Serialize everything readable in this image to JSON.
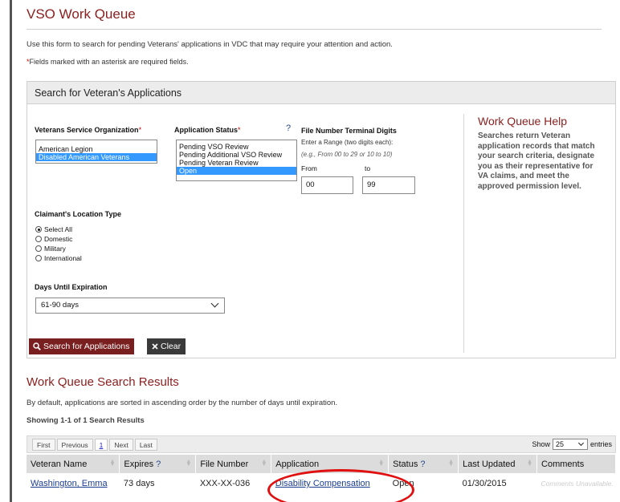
{
  "page": {
    "title": "VSO Work Queue",
    "intro": "Use this form to search for pending Veterans' applications in VDC that may require your attention and action.",
    "required_note_star": "*",
    "required_note": "Fields marked with an asterisk are required fields."
  },
  "search_panel": {
    "header": "Search for Veteran's Applications",
    "vso": {
      "label": "Veterans Service Organization",
      "required": "*",
      "options": [
        "American Legion",
        "Disabled American Veterans"
      ],
      "selected": "Disabled American Veterans"
    },
    "status": {
      "label": "Application Status",
      "required": "*",
      "help": "?",
      "options": [
        "Pending VSO Review",
        "Pending Additional VSO Review",
        "Pending Veteran Review",
        "Open"
      ],
      "selected": "Open"
    },
    "file_number": {
      "label": "File Number Terminal Digits",
      "hint": "Enter a Range (two digits each):",
      "example": "(e.g., From 00 to 29 or 10 to 10)",
      "from_label": "From",
      "to_label": "to",
      "from_value": "00",
      "to_value": "99"
    },
    "location": {
      "label": "Claimant's Location Type",
      "options": [
        "Select All",
        "Domestic",
        "Military",
        "International"
      ],
      "selected": "Select All"
    },
    "days": {
      "label": "Days Until Expiration",
      "value": "61-90 days"
    },
    "search_button": "Search for Applications",
    "clear_button": "Clear",
    "help": {
      "title": "Work Queue Help",
      "text": "Searches return Veteran application records that match your search criteria, designate you as their representative for VA claims, and meet the approved permission level."
    }
  },
  "results": {
    "title": "Work Queue Search Results",
    "description": "By default, applications are sorted in ascending order by the number of days until expiration.",
    "count": "Showing 1-1 of 1 Search Results",
    "pager": {
      "first": "First",
      "previous": "Previous",
      "current": "1",
      "next": "Next",
      "last": "Last"
    },
    "show_label": "Show",
    "show_value": "25",
    "entries_label": "entries",
    "columns": [
      "Veteran Name",
      "Expires",
      "File Number",
      "Application",
      "Status",
      "Last Updated",
      "Comments"
    ],
    "help_mark": "?",
    "rows": [
      {
        "veteran_name": "Washington, Emma",
        "expires": "73 days",
        "file_number": "XXX-XX-036",
        "application": "Disability Compensation",
        "status": "Open",
        "last_updated": "01/30/2015",
        "comments": "Comments Unavailable."
      }
    ]
  },
  "colors": {
    "accent": "#8b2020",
    "selection": "#3399ff",
    "annotation": "#e01010"
  }
}
